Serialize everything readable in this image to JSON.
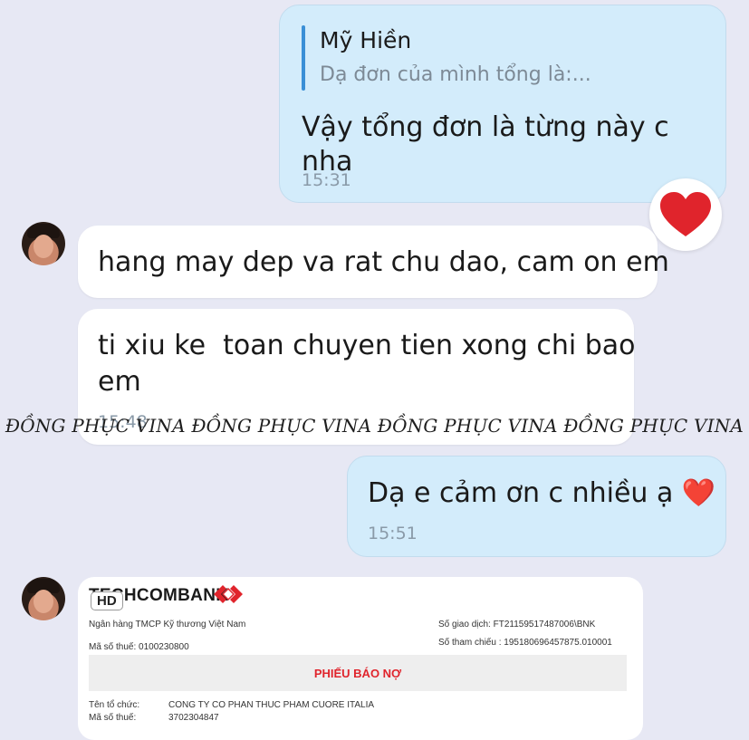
{
  "messages": {
    "outgoing_1": {
      "quote_author": "Mỹ Hiền",
      "quote_preview": "Dạ đơn của mình tổng là:...",
      "text": "Vậy tổng đơn là từng này c nha",
      "time": "15:31",
      "reaction": "❤️"
    },
    "incoming_1": {
      "text": "hang may dep va rat chu dao, cam on em"
    },
    "incoming_2": {
      "text_line1": "ti xiu ke  toan chuyen tien xong chi bao",
      "text_line2": "em",
      "time": "15:48"
    },
    "outgoing_2": {
      "text": "Dạ e cảm ơn c nhiều ạ ❤️",
      "time": "15:51"
    }
  },
  "watermark": "ĐỒNG PHỤC VINA ĐỒNG PHỤC VINA ĐỒNG PHỤC VINA ĐỒNG PHỤC VINA",
  "receipt": {
    "bank_logo": "TECHCOMBANK",
    "hd_badge": "HD",
    "bank_name": "Ngân hàng TMCP Kỹ thương Việt Nam",
    "tax_id_label": "Mã số thuế: 0100230800",
    "transaction_no": "Số giao dịch: FT21159517487006\\BNK",
    "reference_no": "Số tham chiếu : 195180696457875.010001",
    "doc_title": "PHIẾU BÁO NỢ",
    "org_label": "Tên tổ chức:",
    "org_value": "CONG TY CO PHAN THUC PHAM CUORE ITALIA",
    "org_tax_label": "Mã số thuế:",
    "org_tax_value": "3702304847"
  },
  "colors": {
    "background": "#e7e8f4",
    "outgoing_bubble": "#d3ecfb",
    "incoming_bubble": "#ffffff",
    "quote_bar": "#3a8fd6",
    "receipt_title": "#e0242c",
    "heart": "#e0242c"
  }
}
